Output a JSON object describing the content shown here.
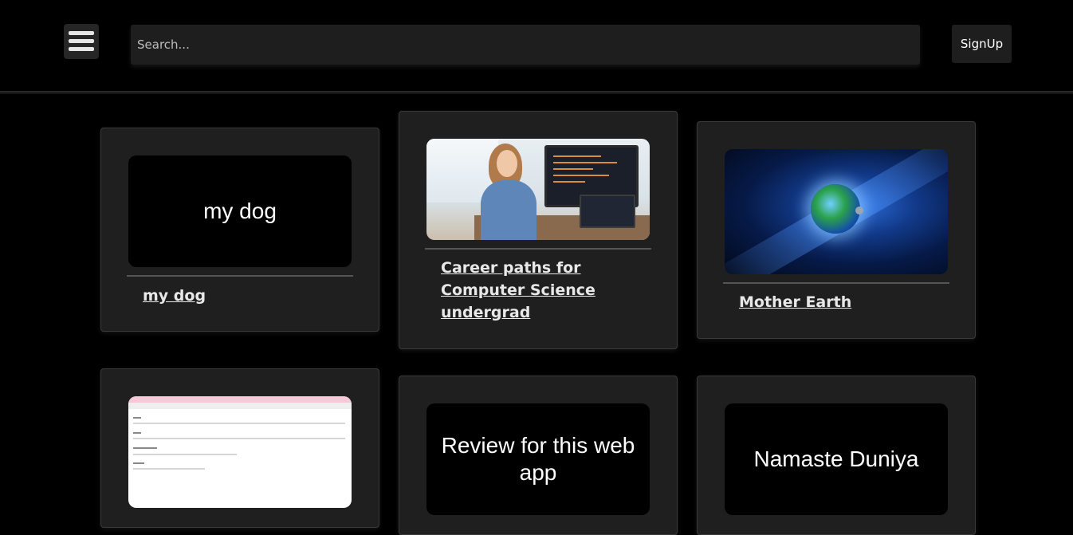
{
  "header": {
    "menu_icon": "hamburger-menu-icon",
    "search_placeholder": "Search...",
    "signup_label": "SignUp"
  },
  "cards": [
    {
      "thumbnail_type": "text",
      "thumbnail_text": "my dog",
      "title": "my dog"
    },
    {
      "thumbnail_type": "image",
      "thumbnail_image": "woman-at-computer-photo",
      "title": "Career paths for Computer Science undergrad"
    },
    {
      "thumbnail_type": "image",
      "thumbnail_image": "earth-in-space-photo",
      "title": "Mother Earth"
    },
    {
      "thumbnail_type": "image",
      "thumbnail_image": "blog-editor-screenshot",
      "title": ""
    },
    {
      "thumbnail_type": "text",
      "thumbnail_text": "Review for this web app",
      "title": ""
    },
    {
      "thumbnail_type": "text",
      "thumbnail_text": "Namaste Duniya",
      "title": ""
    }
  ],
  "colors": {
    "background": "#000000",
    "card": "#1f1f1f",
    "input": "#1e1e1e"
  }
}
